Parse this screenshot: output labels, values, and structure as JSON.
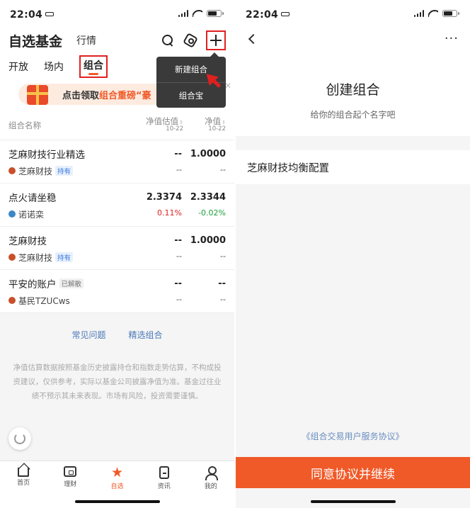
{
  "left": {
    "status": {
      "time": "22:04"
    },
    "header": {
      "title": "自选基金",
      "market": "行情"
    },
    "tabs": [
      "开放",
      "场内",
      "组合"
    ],
    "active_tab": "组合",
    "dropdown": [
      "新建组合",
      "组合宝"
    ],
    "banner": {
      "prefix": "点击领取",
      "highlight": "组合重磅“豪"
    },
    "columns": {
      "name": "组合名称",
      "est_label": "净值估值",
      "est_date": "10-22",
      "nav_label": "净值",
      "nav_date": "10-22"
    },
    "rows": [
      {
        "name": "芝麻财技行业精选",
        "owner": "芝麻财技",
        "tag": "持有",
        "est": "--",
        "est_chg": "--",
        "nav": "1.0000",
        "nav_chg": "--"
      },
      {
        "name": "点火请坐稳",
        "owner": "诺诺栾",
        "tag": "",
        "est": "2.3374",
        "est_chg": "0.11%",
        "nav": "2.3344",
        "nav_chg": "-0.02%"
      },
      {
        "name": "芝麻财技",
        "owner": "芝麻财技",
        "tag": "持有",
        "est": "--",
        "est_chg": "--",
        "nav": "1.0000",
        "nav_chg": "--"
      },
      {
        "name": "平安的账户",
        "owner": "基民TZUCws",
        "tag": "已解散",
        "est": "--",
        "est_chg": "--",
        "nav": "--",
        "nav_chg": "--"
      }
    ],
    "links": {
      "faq": "常见问题",
      "picks": "精选组合"
    },
    "disclaimer": "净值估算数据按照基金历史披露持仓和指数走势估算，不构成投资建议，仅供参考，实际以基金公司披露净值为准。基金过往业绩不预示其未来表现。市场有风险，投资需要谨慎。",
    "nav": [
      {
        "label": "首页"
      },
      {
        "label": "理财"
      },
      {
        "label": "自选"
      },
      {
        "label": "资讯"
      },
      {
        "label": "我的"
      }
    ],
    "colors": {
      "accent": "#f05a28",
      "highlight_box": "#e02020",
      "up": "#e02020",
      "down": "#1a9e3a"
    }
  },
  "right": {
    "status": {
      "time": "22:04"
    },
    "title": "创建组合",
    "subtitle": "给你的组合起个名字吧",
    "name_value": "芝麻财技均衡配置",
    "agreement": "《组合交易用户服务协议》",
    "cta": "同意协议并继续"
  }
}
